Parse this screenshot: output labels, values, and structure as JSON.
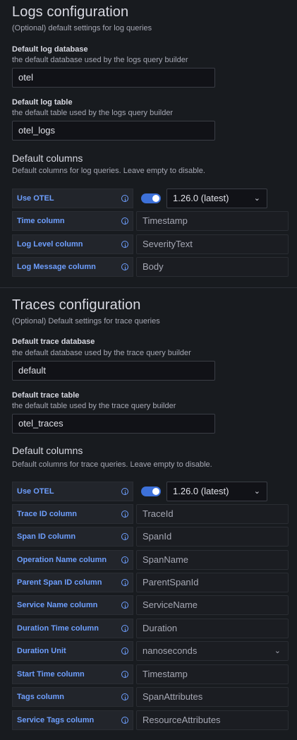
{
  "logs": {
    "title": "Logs configuration",
    "subtitle": "(Optional) default settings for log queries",
    "db_label": "Default log database",
    "db_desc": "the default database used by the logs query builder",
    "db_value": "otel",
    "table_label": "Default log table",
    "table_desc": "the default table used by the logs query builder",
    "table_value": "otel_logs",
    "columns_title": "Default columns",
    "columns_desc": "Default columns for log queries. Leave empty to disable.",
    "otel_label": "Use OTEL",
    "otel_enabled": true,
    "otel_version": "1.26.0 (latest)",
    "rows": [
      {
        "label": "Time column",
        "value": "Timestamp"
      },
      {
        "label": "Log Level column",
        "value": "SeverityText"
      },
      {
        "label": "Log Message column",
        "value": "Body"
      }
    ]
  },
  "traces": {
    "title": "Traces configuration",
    "subtitle": "(Optional) Default settings for trace queries",
    "db_label": "Default trace database",
    "db_desc": "the default database used by the trace query builder",
    "db_value": "default",
    "table_label": "Default trace table",
    "table_desc": "the default table used by the trace query builder",
    "table_value": "otel_traces",
    "columns_title": "Default columns",
    "columns_desc": "Default columns for trace queries. Leave empty to disable.",
    "otel_label": "Use OTEL",
    "otel_enabled": true,
    "otel_version": "1.26.0 (latest)",
    "rows": [
      {
        "label": "Trace ID column",
        "value": "TraceId"
      },
      {
        "label": "Span ID column",
        "value": "SpanId"
      },
      {
        "label": "Operation Name column",
        "value": "SpanName"
      },
      {
        "label": "Parent Span ID column",
        "value": "ParentSpanId"
      },
      {
        "label": "Service Name column",
        "value": "ServiceName"
      },
      {
        "label": "Duration Time column",
        "value": "Duration"
      },
      {
        "label": "Duration Unit",
        "value": "nanoseconds"
      },
      {
        "label": "Start Time column",
        "value": "Timestamp"
      },
      {
        "label": "Tags column",
        "value": "SpanAttributes"
      },
      {
        "label": "Service Tags column",
        "value": "ResourceAttributes"
      }
    ]
  },
  "icons": {
    "info": "info-circle-icon",
    "chevron": "chevron-down-icon"
  },
  "colors": {
    "accent": "#6e9fff",
    "toggle": "#3d71d9",
    "background": "#181b1f"
  }
}
